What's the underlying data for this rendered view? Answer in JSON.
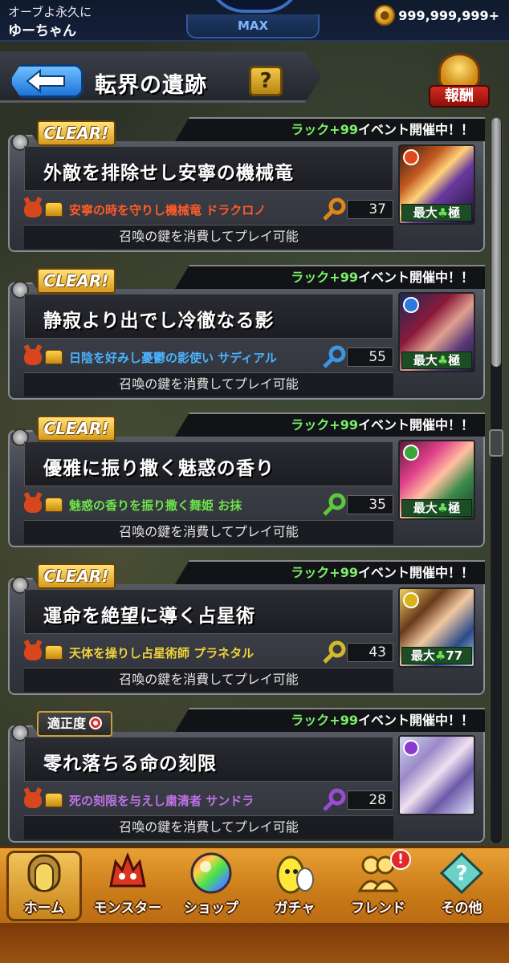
{
  "status_bar": {
    "title": "オーブよ永久に",
    "user_name": "ゆーちゃん",
    "rank_label": "MAX",
    "coins": "999,999,999+"
  },
  "header": {
    "title": "転界の遺跡",
    "help_label": "?",
    "reward_label": "報酬"
  },
  "quests": [
    {
      "status": "CLEAR!",
      "event_highlight": "ラック+99",
      "event_rest": "イベント開催中！！",
      "title": "外敵を排除せし安寧の機械竜",
      "boss": "安寧の時を守りし機械竜 ドラクロノ",
      "boss_color": "#ff5a2a",
      "key_color": "#e0851c",
      "keys": "37",
      "element_color": "#e2481e",
      "luck_prefix": "最大",
      "luck_value": "極",
      "play_note": "召喚の鍵を消費してプレイ可能"
    },
    {
      "status": "CLEAR!",
      "event_highlight": "ラック+99",
      "event_rest": "イベント開催中！！",
      "title": "静寂より出でし冷徹なる影",
      "boss": "日陰を好みし憂鬱の影使い サディアル",
      "boss_color": "#4ab2ff",
      "key_color": "#3b95e0",
      "keys": "55",
      "element_color": "#2a7ae0",
      "luck_prefix": "最大",
      "luck_value": "極",
      "play_note": "召喚の鍵を消費してプレイ可能"
    },
    {
      "status": "CLEAR!",
      "event_highlight": "ラック+99",
      "event_rest": "イベント開催中！！",
      "title": "優雅に振り撒く魅惑の香り",
      "boss": "魅惑の香りを振り撒く舞姫 お抹",
      "boss_color": "#6ee24a",
      "key_color": "#5cc83a",
      "keys": "35",
      "element_color": "#3aa63a",
      "luck_prefix": "最大",
      "luck_value": "極",
      "play_note": "召喚の鍵を消費してプレイ可能"
    },
    {
      "status": "CLEAR!",
      "event_highlight": "ラック+99",
      "event_rest": "イベント開催中！！",
      "title": "運命を絶望に導く占星術",
      "boss": "天体を操りし占星術師 プラネタル",
      "boss_color": "#f0d23a",
      "key_color": "#d6b82a",
      "keys": "43",
      "element_color": "#d8b418",
      "luck_prefix": "最大",
      "luck_value": "77",
      "play_note": "召喚の鍵を消費してプレイ可能"
    },
    {
      "status": "適正度",
      "event_highlight": "ラック+99",
      "event_rest": "イベント開催中！！",
      "title": "零れ落ちる命の刻限",
      "boss": "死の刻限を与えし粛清者 サンドラ",
      "boss_color": "#c072e8",
      "key_color": "#9b4ad8",
      "keys": "28",
      "element_color": "#8a3ad0",
      "luck_prefix": "",
      "luck_value": "",
      "play_note": "召喚の鍵を消費してプレイ可能"
    }
  ],
  "nav": {
    "home": "ホーム",
    "monster": "モンスター",
    "shop": "ショップ",
    "gacha": "ガチャ",
    "friend": "フレンド",
    "other": "その他",
    "friend_notif": "!"
  }
}
